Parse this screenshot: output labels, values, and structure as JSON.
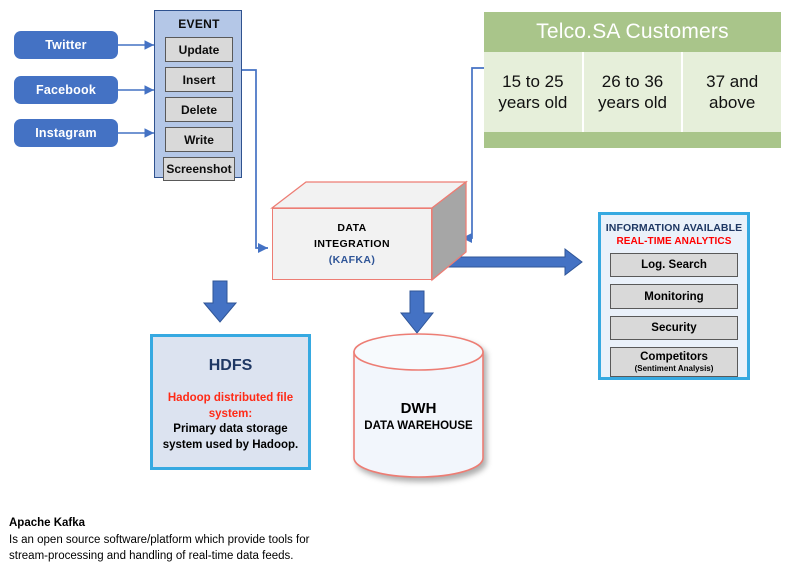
{
  "sources": [
    {
      "label": "Twitter"
    },
    {
      "label": "Facebook"
    },
    {
      "label": "Instagram"
    }
  ],
  "event_panel": {
    "title": "EVENT",
    "items": [
      {
        "label": "Update"
      },
      {
        "label": "Insert"
      },
      {
        "label": "Delete"
      },
      {
        "label": "Write"
      },
      {
        "label": "Screenshot"
      }
    ]
  },
  "telco_table": {
    "title": "Telco.SA Customers",
    "columns": [
      {
        "line1": "15 to 25",
        "line2": "years old"
      },
      {
        "line1": "26 to 36",
        "line2": "years old"
      },
      {
        "line1": "37 and",
        "line2": "above"
      }
    ]
  },
  "kafka": {
    "line1": "DATA",
    "line2": "INTEGRATION",
    "line3": "(KAFKA)"
  },
  "hdfs": {
    "title": "HDFS",
    "red_line1": "Hadoop distributed file",
    "red_line2": "system:",
    "black_line1": "Primary data storage",
    "black_line2": "system used by Hadoop."
  },
  "dwh": {
    "title": "DWH",
    "subtitle": "DATA WAREHOUSE"
  },
  "info_panel": {
    "title": "INFORMATION AVAILABLE",
    "subtitle": "REAL-TIME ANALYTICS",
    "items": [
      {
        "label": "Log. Search",
        "sub": ""
      },
      {
        "label": "Monitoring",
        "sub": ""
      },
      {
        "label": "Security",
        "sub": ""
      },
      {
        "label": "Competitors",
        "sub": "(Sentiment Analysis)"
      }
    ]
  },
  "caption": {
    "title": "Apache Kafka",
    "line1": "Is an open source software/platform which provide tools for",
    "line2": "stream-processing and handling of real-time data feeds."
  },
  "colors": {
    "source_blue": "#4472C4",
    "event_panel_fill": "#B4C7E7",
    "event_item_fill": "#D9D9D9",
    "telco_green_header": "#A9C58A",
    "telco_green_cell": "#E6EFDA",
    "kafka_outline": "#ED7D74",
    "panel_border_cyan": "#36A9E1",
    "accent_red": "#FF0000",
    "navy": "#1F3864"
  }
}
